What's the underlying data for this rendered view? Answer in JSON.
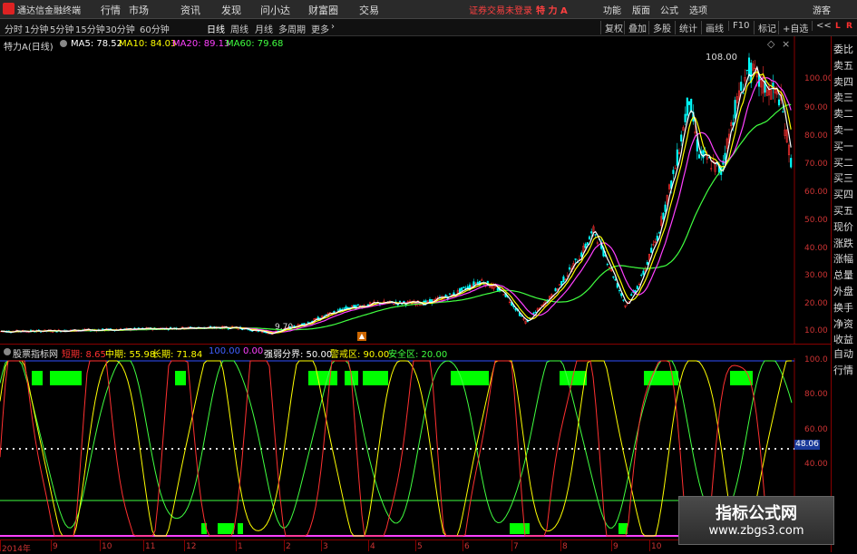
{
  "menubar": {
    "app_name": "通达信金融终端",
    "menus": [
      "行情",
      "市场",
      "资讯",
      "发现",
      "问小达",
      "财富圈",
      "交易"
    ],
    "warning": "证券交易未登录",
    "stock_name": "特 力 A",
    "right": [
      "功能",
      "版面",
      "公式",
      "选项",
      "游客"
    ]
  },
  "periodbar": {
    "periods": [
      "分时",
      "1分钟",
      "5分钟",
      "15分钟",
      "30分钟",
      "60分钟",
      "日线",
      "周线",
      "月线",
      "多周期",
      "更多"
    ],
    "active": "日线",
    "tools": [
      "复权",
      "叠加",
      "多股",
      "统计",
      "画线",
      "F10",
      "标记",
      "+自选",
      "<<"
    ]
  },
  "main_info": {
    "title": "特力A(日线)",
    "ma": [
      {
        "label": "MA5: 78.52",
        "color": "#ffffff"
      },
      {
        "label": "MA10: 84.03",
        "color": "#ffff00"
      },
      {
        "label": "MA20: 89.13",
        "color": "#ff40ff"
      },
      {
        "label": "MA60: 79.68",
        "color": "#40ff40"
      }
    ]
  },
  "main_chart": {
    "y_ticks": [
      "100.00",
      "90.00",
      "80.00",
      "70.00",
      "60.00",
      "50.00",
      "40.00",
      "30.00",
      "20.00",
      "10.00"
    ],
    "peak_label": "108.00",
    "low_label": "9.70"
  },
  "indicator": {
    "name": "股票指标网",
    "items": [
      {
        "label": "短期: 8.65",
        "color": "#ff3030"
      },
      {
        "label": "中期: 55.98",
        "color": "#ffff00"
      },
      {
        "label": "长期: 71.84",
        "color": "#ffff00"
      },
      {
        "label": "100.00",
        "color": "#4060ff"
      },
      {
        "label": "0.00",
        "color": "#ff40ff"
      },
      {
        "label": "强弱分界: 50.00",
        "color": "#ffffff"
      },
      {
        "label": "警戒区: 90.00",
        "color": "#ffff00"
      },
      {
        "label": "安全区: 20.00",
        "color": "#40ff40"
      }
    ],
    "y_ticks": [
      "100.0",
      "80.00",
      "60.00",
      "40.00"
    ],
    "current": "48.06"
  },
  "x_axis": [
    "2014年",
    "9",
    "10",
    "11",
    "12",
    "1",
    "2",
    "3",
    "4",
    "5",
    "6",
    "7",
    "8",
    "9",
    "10"
  ],
  "right_col": [
    "L",
    "R",
    "委比",
    "卖五",
    "卖四",
    "卖三",
    "卖二",
    "卖一",
    "买一",
    "买二",
    "买三",
    "买四",
    "买五",
    "现价",
    "涨跌",
    "涨幅",
    "总量",
    "外盘",
    "换手",
    "净资",
    "收益",
    "自动",
    "行情"
  ],
  "watermark": {
    "line1": "指标公式网",
    "line2": "www.zbgs3.com"
  },
  "colors": {
    "up": "#ff3030",
    "down": "#00ffff",
    "ma5": "#ffffff",
    "ma10": "#ffff00",
    "ma20": "#ff40ff",
    "ma60": "#40ff40",
    "signal": "#00ff00"
  }
}
